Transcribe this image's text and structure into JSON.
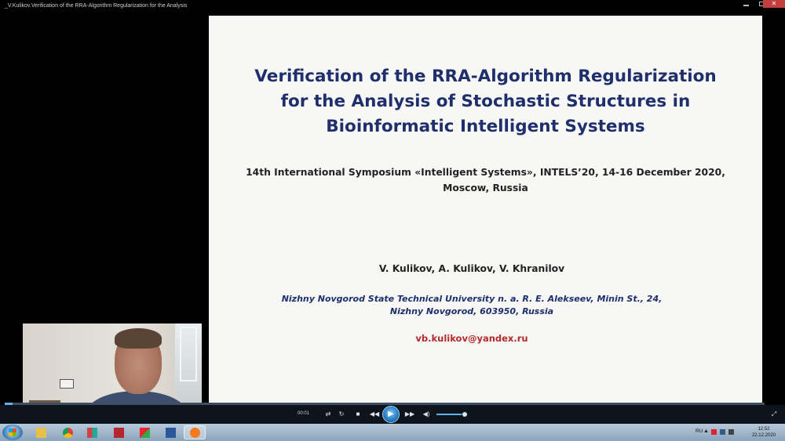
{
  "window": {
    "title": "_V.Kulikov.Verification of the RRA-Algorithm Regularization for the Analysis",
    "close_glyph": "✕"
  },
  "slide": {
    "title_lines": [
      "Verification of the RRA-Algorithm Regularization",
      "for the Analysis of Stochastic Structures in",
      "Bioinformatic Intelligent Systems"
    ],
    "conference_lines": [
      "14th International Symposium «Intelligent Systems», INTELS’20, 14-16 December 2020,",
      "Moscow, Russia"
    ],
    "authors": "V. Kulikov, A. Kulikov, V. Khranilov",
    "affiliation_lines": [
      "Nizhny Novgorod State Technical University n. a. R. E. Alekseev, Minin St., 24,",
      "Nizhny Novgorod, 603950, Russia"
    ],
    "email": "vb.kulikov@yandex.ru"
  },
  "player": {
    "elapsed": "00:01",
    "progress_fraction": 0.01,
    "volume_fraction": 0.85,
    "icons": {
      "shuffle": "⇄",
      "repeat": "↻",
      "stop": "■",
      "prev": "◀◀",
      "play": "▶",
      "next": "▶▶",
      "volume": "◀)",
      "fullscreen": "⤢"
    }
  },
  "taskbar": {
    "apps": [
      "start",
      "file-explorer",
      "chrome",
      "app",
      "app",
      "app",
      "word",
      "windows-media-player"
    ],
    "tray": {
      "language": "RU",
      "time": "12:52",
      "date": "22.12.2020",
      "show_hidden_glyph": "▲"
    }
  }
}
